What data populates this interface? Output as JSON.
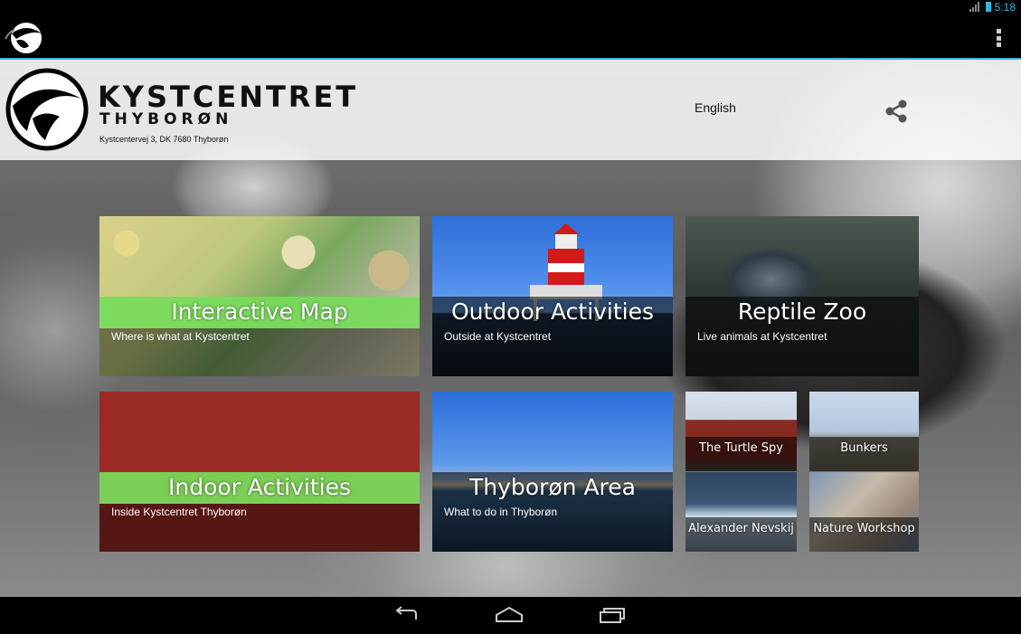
{
  "status_bar": {
    "time": "5:18",
    "network": "3G"
  },
  "header": {
    "brand_name": "KYSTCENTRET",
    "brand_town": "THYBORØN",
    "address": "Kystcentervej 3, DK 7680 Thyborøn",
    "language": "English",
    "share_icon": "share-icon"
  },
  "tiles": [
    {
      "title": "Interactive Map",
      "subtitle": "Where is what at Kystcentret"
    },
    {
      "title": "Outdoor Activities",
      "subtitle": "Outside at Kystcentret"
    },
    {
      "title": "Reptile Zoo",
      "subtitle": "Live animals at Kystcentret"
    },
    {
      "title": "Indoor Activities",
      "subtitle": "Inside Kystcentret Thyborøn"
    },
    {
      "title": "Thyborøn Area",
      "subtitle": "What to do in Thyborøn"
    },
    {
      "title": "The Turtle Spy"
    },
    {
      "title": "Bunkers"
    },
    {
      "title": "Alexander Nevskij"
    },
    {
      "title": "Nature Workshop"
    }
  ],
  "colors": {
    "accent": "#33b5e5",
    "highlight_green": "#78dc5a"
  }
}
